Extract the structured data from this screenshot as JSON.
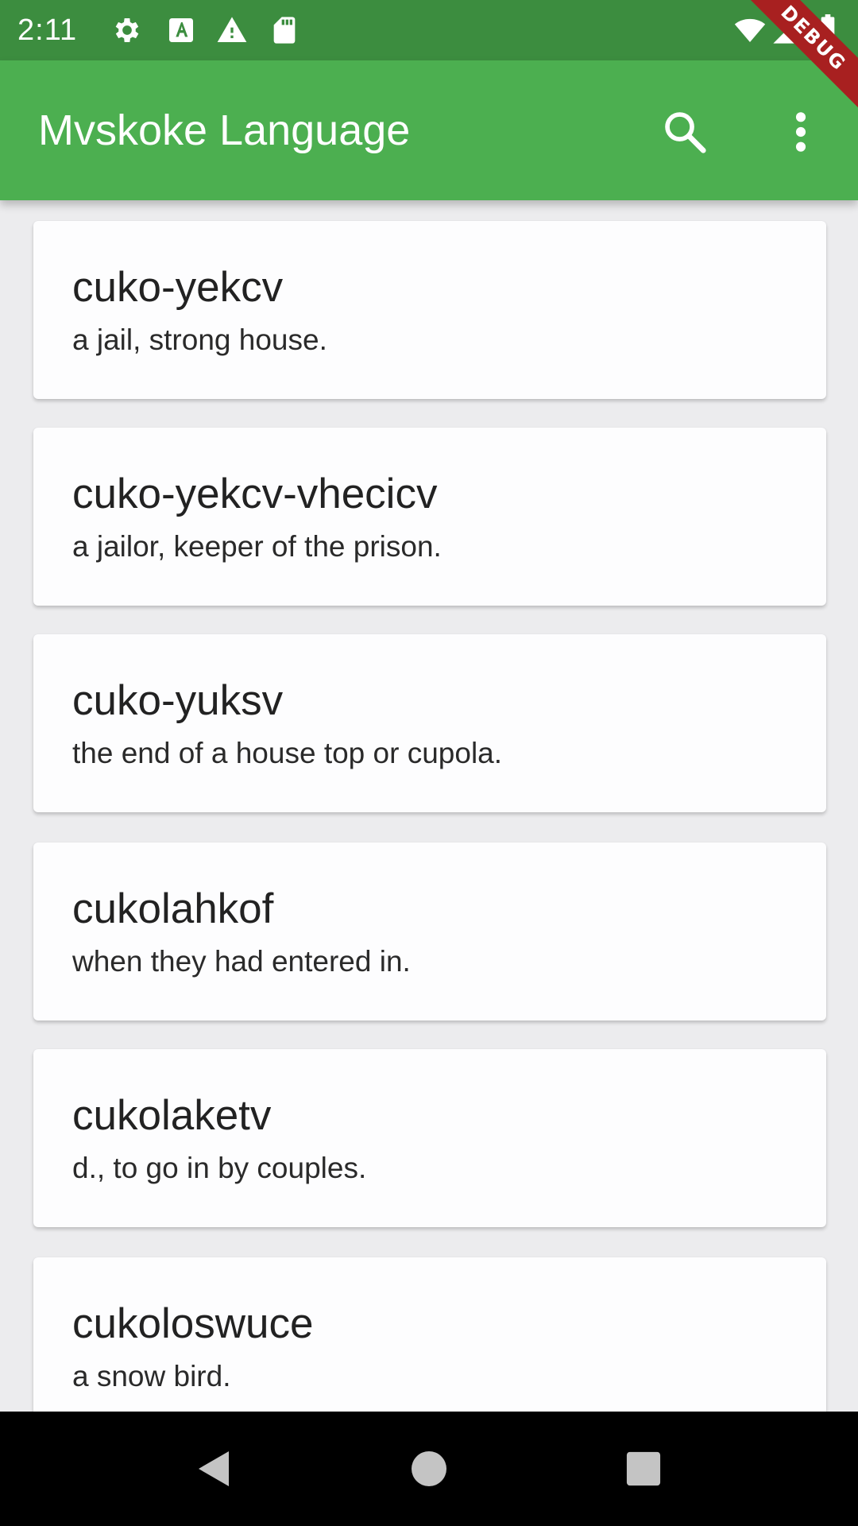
{
  "status_bar": {
    "time": "2:11",
    "icons": [
      "settings-icon",
      "text-a-icon",
      "warning-icon",
      "sd-card-icon",
      "wifi-icon",
      "signal-icon",
      "battery-icon"
    ]
  },
  "debug_banner": "DEBUG",
  "app_bar": {
    "title": "Mvskoke Language",
    "actions": [
      "search-icon",
      "more-vert-icon"
    ]
  },
  "entries": [
    {
      "word": "cuko-yekcv",
      "definition": "a jail, strong house."
    },
    {
      "word": "cuko-yekcv-vhecicv",
      "definition": "a jailor, keeper of the prison."
    },
    {
      "word": "cuko-yuksv",
      "definition": "the end of a house top or cupola."
    },
    {
      "word": "cukolahkof",
      "definition": "when they had entered in."
    },
    {
      "word": "cukolaketv",
      "definition": "d., to go in by couples."
    },
    {
      "word": "cukoloswuce",
      "definition": "a snow bird."
    }
  ],
  "nav_bar": {
    "buttons": [
      "back-icon",
      "home-icon",
      "recents-icon"
    ]
  },
  "colors": {
    "status_bar": "#3c8d3f",
    "app_bar": "#4caf50",
    "card": "#fdfdfe",
    "background": "#ececee",
    "debug": "#a82020"
  }
}
